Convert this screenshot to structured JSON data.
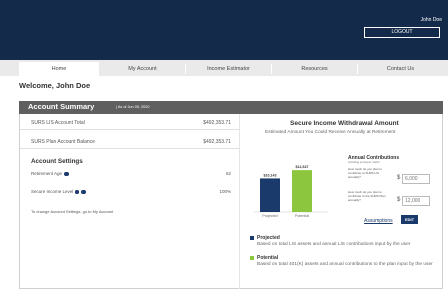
{
  "header": {
    "user_name": "John Doe",
    "logout_label": "LOGOUT"
  },
  "nav": {
    "items": [
      "Home",
      "My Account",
      "Income Estimator",
      "Resources",
      "Contact Us"
    ]
  },
  "welcome": "Welcome, John Doe",
  "summary": {
    "title": "Account Summary",
    "as_of": "| As of Jun 09, 2020",
    "rows": [
      {
        "label": "SURS LIS Account Total",
        "value": "$492,353.71"
      },
      {
        "label": "SURS Plan Account Balance",
        "value": "$492,353.71"
      }
    ]
  },
  "settings": {
    "title": "Account Settings",
    "retirement_age_label": "Retirement Age",
    "retirement_age_value": "62",
    "secure_income_label": "Secure Income Level",
    "secure_income_value": "100%",
    "change_text": "To change Account Settings, go to My Account"
  },
  "siwa": {
    "title": "Secure Income Withdrawal Amount",
    "subtitle": "Estimated Amount You Could Receive Annually at Retirement"
  },
  "chart_data": {
    "type": "bar",
    "categories": [
      "Projected",
      "Potential"
    ],
    "values": [
      10143,
      12647
    ],
    "data_labels": [
      "$10,143",
      "$12,647"
    ],
    "colors": [
      "#1a3a6b",
      "#8cc63f"
    ],
    "ylim": [
      0,
      14500
    ]
  },
  "contributions": {
    "title": "Annual Contributions",
    "note": "including employer match",
    "q1": "How much do you plan to contribute to SURS LIS annually?",
    "q1_placeholder": "6,000",
    "q2": "How much do you plan to contribute to the SURS Plan annually?",
    "q2_placeholder": "12,000",
    "dollar_sign": "$",
    "assumptions_label": "Assumptions",
    "edit_label": "EDIT"
  },
  "legend": {
    "projected_title": "Projected",
    "projected_desc": "Based on total LIS assets and annual LIS contributions input by the user",
    "potential_title": "Potential",
    "potential_desc": "Based on total 401(K) assets and annual contributions to the plan input by the user"
  }
}
